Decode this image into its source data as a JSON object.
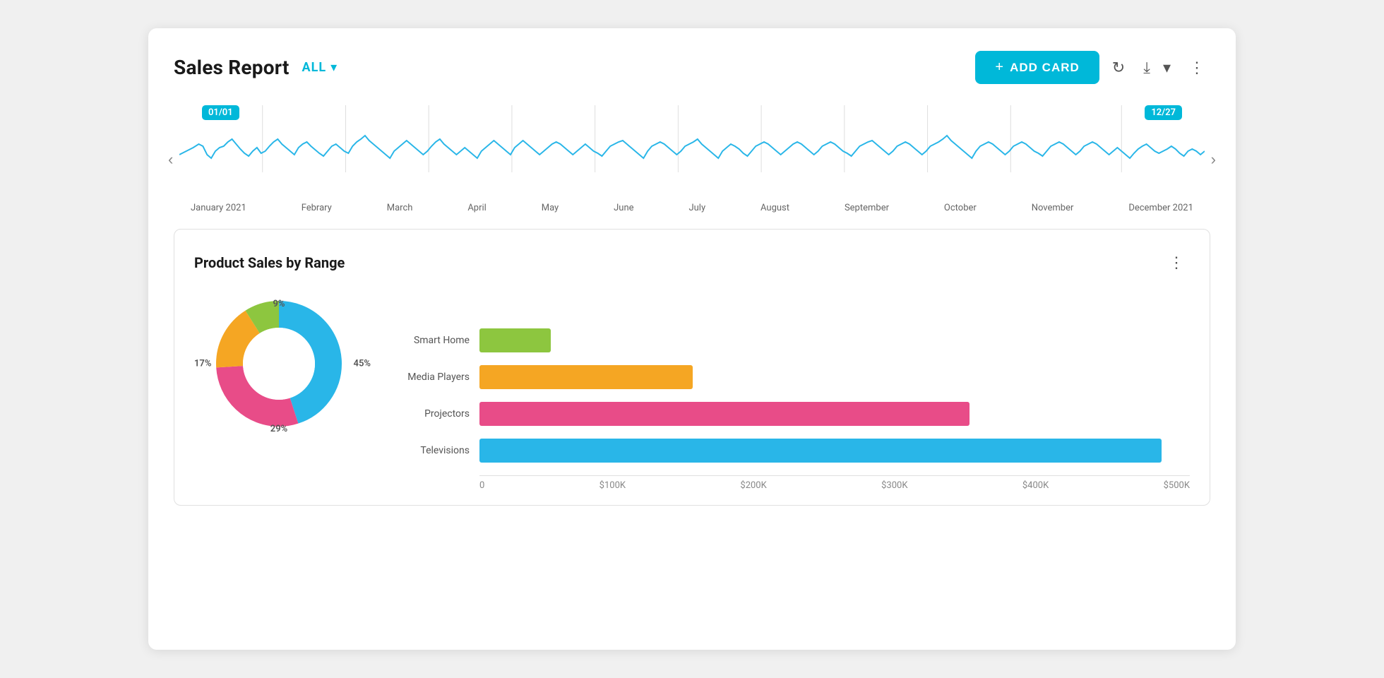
{
  "header": {
    "title": "Sales Report",
    "filter_label": "ALL",
    "add_card_label": "ADD CARD",
    "plus_symbol": "+"
  },
  "toolbar": {
    "refresh_icon": "↻",
    "export_icon": "⤓",
    "more_icon": "⋮",
    "chevron_down": "▾"
  },
  "timeline": {
    "date_start": "01/01",
    "date_end": "12/27",
    "nav_left": "‹",
    "nav_right": "›",
    "months": [
      "January 2021",
      "Febrary",
      "March",
      "April",
      "May",
      "June",
      "July",
      "August",
      "September",
      "October",
      "November",
      "December 2021"
    ]
  },
  "product_sales": {
    "title": "Product Sales by Range",
    "more_icon": "⋮",
    "donut": {
      "segments": [
        {
          "label": "45%",
          "value": 45,
          "color": "#29b6e8"
        },
        {
          "label": "29%",
          "value": 29,
          "color": "#e84c88"
        },
        {
          "label": "17%",
          "value": 17,
          "color": "#f5a623"
        },
        {
          "label": "9%",
          "value": 9,
          "color": "#8dc63f"
        }
      ]
    },
    "bars": [
      {
        "label": "Smart Home",
        "value": 55000,
        "max": 550000,
        "color": "#8dc63f"
      },
      {
        "label": "Media Players",
        "value": 165000,
        "max": 550000,
        "color": "#f5a623"
      },
      {
        "label": "Projectors",
        "value": 380000,
        "max": 550000,
        "color": "#e84c88"
      },
      {
        "label": "Televisions",
        "value": 530000,
        "max": 550000,
        "color": "#29b6e8"
      }
    ],
    "axis_labels": [
      "0",
      "$100K",
      "$200K",
      "$300K",
      "$400K",
      "$500K"
    ]
  }
}
